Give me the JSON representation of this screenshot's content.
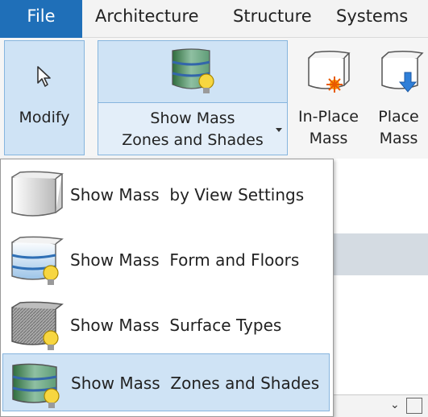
{
  "menubar": {
    "file": "File",
    "architecture": "Architecture",
    "structure": "Structure",
    "systems": "Systems"
  },
  "ribbon": {
    "modify_label": "Modify",
    "show_mass_line1": "Show Mass",
    "show_mass_line2": "Zones and Shades",
    "inplace_line1": "In-Place",
    "inplace_line2": "Mass",
    "place_line1": "Place",
    "place_line2": "Mass"
  },
  "dropdown": {
    "items": [
      {
        "label": "Show Mass  by View Settings",
        "icon": "mass-view-settings-icon"
      },
      {
        "label": "Show Mass  Form and Floors",
        "icon": "mass-form-floors-icon"
      },
      {
        "label": "Show Mass  Surface Types",
        "icon": "mass-surface-types-icon"
      },
      {
        "label": "Show Mass  Zones and Shades",
        "icon": "mass-zones-shades-icon",
        "selected": true
      }
    ]
  },
  "colors": {
    "file_tab": "#1f6fb8",
    "selected_bg": "#cfe3f5",
    "selected_border": "#86b5de"
  }
}
